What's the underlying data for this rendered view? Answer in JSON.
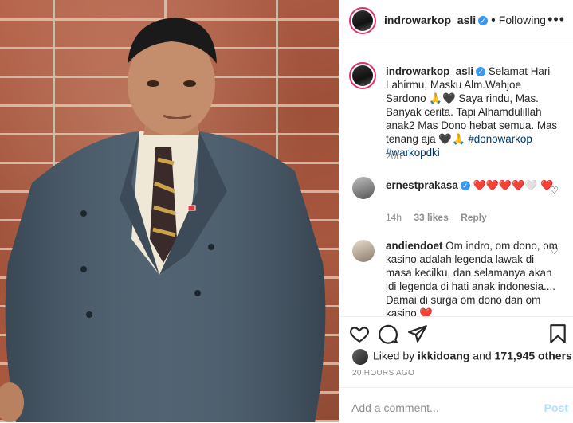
{
  "post": {
    "username": "indrowarkop_asli",
    "follow_status": "Following",
    "caption": "Selamat Hari Lahirmu, Masku Alm.Wahjoe Sardono 🙏🖤 Saya rindu, Mas. Banyak cerita. Tapi Alhamdulillah anak2 Mas Dono hebat semua. Mas tenang aja 🖤🙏",
    "hashtags": "#donowarkop #warkopdki",
    "caption_time": "20h"
  },
  "comments": [
    {
      "username": "ernestprakasa",
      "text": "❤️❤️❤️❤️🤍 ❤️",
      "time": "14h",
      "likes": "33 likes",
      "reply": "Reply"
    },
    {
      "username": "andiendoet",
      "text": "Om indro, om dono, om kasino adalah legenda lawak di masa kecilku, dan selamanya akan jdi legenda di hati anak indonesia.... Damai di surga om dono dan om kasino ❤️"
    }
  ],
  "liked_by": {
    "prefix": "Liked by",
    "user": "ikkidoang",
    "and": "and",
    "others": "171,945 others"
  },
  "timestamp": "20 HOURS AGO",
  "add_comment": {
    "placeholder": "Add a comment...",
    "post_label": "Post"
  },
  "colors": {
    "link_blue": "#00376b",
    "verified_blue": "#3897f0",
    "heart_red": "#ed4956",
    "muted_gray": "#8e8e8e"
  }
}
